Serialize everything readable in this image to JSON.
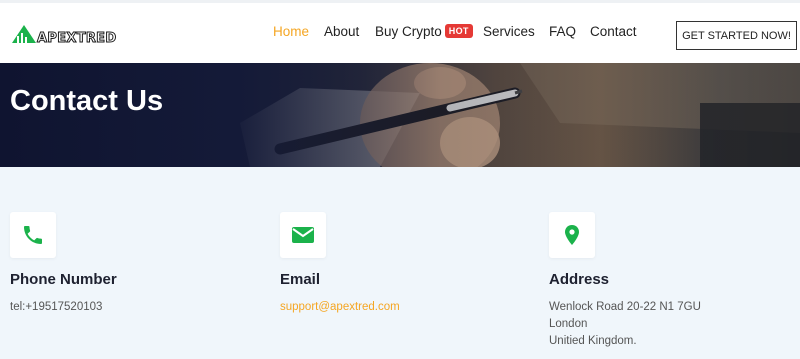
{
  "brand": {
    "name": "APEXTRED",
    "accent": "#f5a623",
    "icon_color": "#1bb24b"
  },
  "nav": {
    "items": [
      {
        "label": "Home",
        "active": true
      },
      {
        "label": "About"
      },
      {
        "label": "Buy Crypto",
        "badge": "HOT"
      },
      {
        "label": "Services"
      },
      {
        "label": "FAQ"
      },
      {
        "label": "Contact"
      }
    ],
    "cta_label": "GET STARTED NOW!"
  },
  "banner": {
    "title": "Contact Us"
  },
  "contacts": {
    "phone": {
      "icon": "phone-icon",
      "title": "Phone Number",
      "line1": "tel:+19517520103"
    },
    "email": {
      "icon": "envelope-icon",
      "title": "Email",
      "line1": "support@apextred.com"
    },
    "address": {
      "icon": "location-pin-icon",
      "title": "Address",
      "line1": "Wenlock Road 20-22 N1 7GU",
      "line2": "London",
      "line3": "Unitied Kingdom."
    }
  }
}
